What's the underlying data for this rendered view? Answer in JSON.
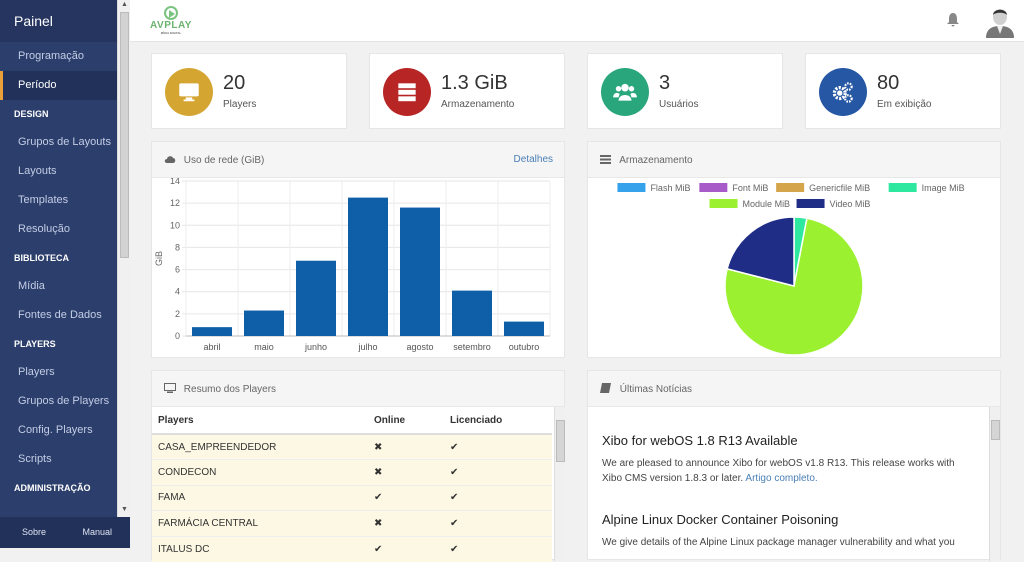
{
  "sidebar": {
    "title": "Painel",
    "items": [
      {
        "label": "Programação",
        "type": "item"
      },
      {
        "label": "Período",
        "type": "item",
        "active": true
      },
      {
        "label": "DESIGN",
        "type": "section"
      },
      {
        "label": "Grupos de Layouts",
        "type": "item"
      },
      {
        "label": "Layouts",
        "type": "item"
      },
      {
        "label": "Templates",
        "type": "item"
      },
      {
        "label": "Resolução",
        "type": "item"
      },
      {
        "label": "BIBLIOTECA",
        "type": "section"
      },
      {
        "label": "Mídia",
        "type": "item"
      },
      {
        "label": "Fontes de Dados",
        "type": "item"
      },
      {
        "label": "PLAYERS",
        "type": "section"
      },
      {
        "label": "Players",
        "type": "item"
      },
      {
        "label": "Grupos de Players",
        "type": "item"
      },
      {
        "label": "Config. Players",
        "type": "item"
      },
      {
        "label": "Scripts",
        "type": "item"
      },
      {
        "label": "ADMINISTRAÇÃO",
        "type": "section"
      }
    ],
    "footer": {
      "about": "Sobre",
      "manual": "Manual"
    }
  },
  "header": {
    "logo_text": "AVPLAY",
    "logo_subtext": "MÍDIA DIGITAL",
    "icons": [
      "bell-icon",
      "user-avatar"
    ]
  },
  "stats": [
    {
      "value": "20",
      "label": "Players",
      "icon": "monitor-icon",
      "color": "#d4a531"
    },
    {
      "value": "1.3 GiB",
      "label": "Armazenamento",
      "icon": "server-icon",
      "color": "#b82525"
    },
    {
      "value": "3",
      "label": "Usuários",
      "icon": "users-icon",
      "color": "#2aa67c"
    },
    {
      "value": "80",
      "label": "Em exibição",
      "icon": "cogs-icon",
      "color": "#2557a4"
    }
  ],
  "network_panel": {
    "title": "Uso de rede (GiB)",
    "link": "Detalhes"
  },
  "storage_panel": {
    "title": "Armazenamento"
  },
  "players_panel": {
    "title": "Resumo dos Players",
    "columns": [
      "Players",
      "Online",
      "Licenciado"
    ],
    "rows": [
      {
        "name": "CASA_EMPREENDEDOR",
        "online": "✖",
        "licensed": "✔"
      },
      {
        "name": "CONDECON",
        "online": "✖",
        "licensed": "✔"
      },
      {
        "name": "FAMA",
        "online": "✔",
        "licensed": "✔"
      },
      {
        "name": "FARMÁCIA CENTRAL",
        "online": "✖",
        "licensed": "✔"
      },
      {
        "name": "ITALUS DC",
        "online": "✔",
        "licensed": "✔"
      }
    ]
  },
  "news_panel": {
    "title": "Últimas Notícias",
    "articles": [
      {
        "title": "Xibo for webOS 1.8 R13 Available",
        "body": "We are pleased to announce Xibo for webOS v1.8 R13. This release works with Xibo CMS version 1.8.3 or later.",
        "link": "Artigo completo."
      },
      {
        "title": "Alpine Linux Docker Container Poisoning",
        "body": "We give details of the Alpine Linux package manager vulnerability and what you",
        "link": ""
      }
    ]
  },
  "chart_data": [
    {
      "type": "bar",
      "title": "Uso de rede (GiB)",
      "categories": [
        "abril",
        "maio",
        "junho",
        "julho",
        "agosto",
        "setembro",
        "outubro"
      ],
      "values": [
        0.8,
        2.3,
        6.8,
        12.5,
        11.6,
        4.1,
        1.3
      ],
      "xlabel": "",
      "ylabel": "GiB",
      "ylim": [
        0,
        14
      ],
      "yticks": [
        0,
        2,
        4,
        6,
        8,
        10,
        12,
        14
      ],
      "grid": true,
      "color": "#0e5fa8"
    },
    {
      "type": "pie",
      "title": "Armazenamento",
      "legend_position": "top",
      "series": [
        {
          "name": "Flash MiB",
          "value": 0,
          "color": "#36a2eb"
        },
        {
          "name": "Font MiB",
          "value": 0,
          "color": "#a65bc8"
        },
        {
          "name": "Genericfile MiB",
          "value": 0,
          "color": "#d4a54a"
        },
        {
          "name": "Image MiB",
          "value": 3,
          "color": "#2ee8a0"
        },
        {
          "name": "Module MiB",
          "value": 76,
          "color": "#9bf030"
        },
        {
          "name": "Video MiB",
          "value": 21,
          "color": "#1f2d86"
        }
      ]
    }
  ]
}
